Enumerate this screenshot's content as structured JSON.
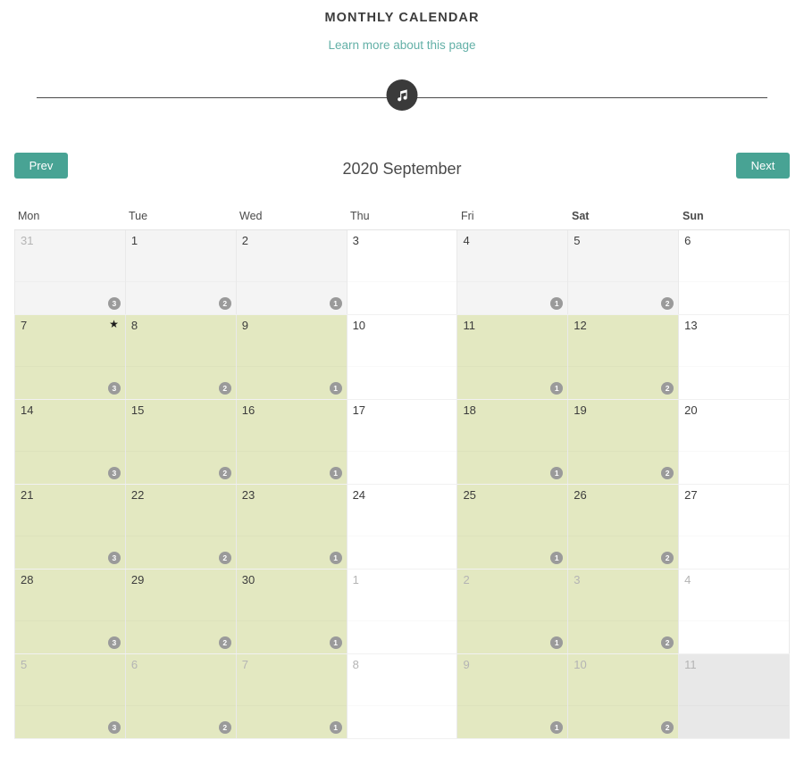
{
  "header": {
    "title": "MONTHLY CALENDAR",
    "subtitle_link": "Learn more about this page",
    "divider_icon": "music-note-icon"
  },
  "colors": {
    "accent_teal": "#48a394",
    "link_teal": "#63b0a7",
    "highlight_green": "#e3e8c1",
    "shade_grey": "#f4f4f4",
    "dim_grey": "#e8e8e8",
    "badge_grey": "#9a9a9a",
    "divider_dark": "#3a3a3a"
  },
  "nav": {
    "prev_label": "Prev",
    "next_label": "Next",
    "month_label": "2020 September"
  },
  "weekdays": [
    {
      "label": "Mon",
      "weekend": false
    },
    {
      "label": "Tue",
      "weekend": false
    },
    {
      "label": "Wed",
      "weekend": false
    },
    {
      "label": "Thu",
      "weekend": false
    },
    {
      "label": "Fri",
      "weekend": false
    },
    {
      "label": "Sat",
      "weekend": true
    },
    {
      "label": "Sun",
      "weekend": true
    }
  ],
  "calendar": {
    "rows": [
      {
        "cells": [
          {
            "date": "31",
            "othermonth": true,
            "shade": "grey",
            "badge": "3",
            "star": false
          },
          {
            "date": "1",
            "othermonth": false,
            "shade": "grey",
            "badge": "2",
            "star": false
          },
          {
            "date": "2",
            "othermonth": false,
            "shade": "grey",
            "badge": "1",
            "star": false
          },
          {
            "date": "3",
            "othermonth": false,
            "shade": "none",
            "badge": "",
            "star": false
          },
          {
            "date": "4",
            "othermonth": false,
            "shade": "grey",
            "badge": "1",
            "star": false
          },
          {
            "date": "5",
            "othermonth": false,
            "shade": "grey",
            "badge": "2",
            "star": false
          },
          {
            "date": "6",
            "othermonth": false,
            "shade": "none",
            "badge": "",
            "star": false
          }
        ]
      },
      {
        "cells": [
          {
            "date": "7",
            "othermonth": false,
            "shade": "green",
            "badge": "3",
            "star": true
          },
          {
            "date": "8",
            "othermonth": false,
            "shade": "green",
            "badge": "2",
            "star": false
          },
          {
            "date": "9",
            "othermonth": false,
            "shade": "green",
            "badge": "1",
            "star": false
          },
          {
            "date": "10",
            "othermonth": false,
            "shade": "none",
            "badge": "",
            "star": false
          },
          {
            "date": "11",
            "othermonth": false,
            "shade": "green",
            "badge": "1",
            "star": false
          },
          {
            "date": "12",
            "othermonth": false,
            "shade": "green",
            "badge": "2",
            "star": false
          },
          {
            "date": "13",
            "othermonth": false,
            "shade": "none",
            "badge": "",
            "star": false
          }
        ]
      },
      {
        "cells": [
          {
            "date": "14",
            "othermonth": false,
            "shade": "green",
            "badge": "3",
            "star": false
          },
          {
            "date": "15",
            "othermonth": false,
            "shade": "green",
            "badge": "2",
            "star": false
          },
          {
            "date": "16",
            "othermonth": false,
            "shade": "green",
            "badge": "1",
            "star": false
          },
          {
            "date": "17",
            "othermonth": false,
            "shade": "none",
            "badge": "",
            "star": false
          },
          {
            "date": "18",
            "othermonth": false,
            "shade": "green",
            "badge": "1",
            "star": false
          },
          {
            "date": "19",
            "othermonth": false,
            "shade": "green",
            "badge": "2",
            "star": false
          },
          {
            "date": "20",
            "othermonth": false,
            "shade": "none",
            "badge": "",
            "star": false
          }
        ]
      },
      {
        "cells": [
          {
            "date": "21",
            "othermonth": false,
            "shade": "green",
            "badge": "3",
            "star": false
          },
          {
            "date": "22",
            "othermonth": false,
            "shade": "green",
            "badge": "2",
            "star": false
          },
          {
            "date": "23",
            "othermonth": false,
            "shade": "green",
            "badge": "1",
            "star": false
          },
          {
            "date": "24",
            "othermonth": false,
            "shade": "none",
            "badge": "",
            "star": false
          },
          {
            "date": "25",
            "othermonth": false,
            "shade": "green",
            "badge": "1",
            "star": false
          },
          {
            "date": "26",
            "othermonth": false,
            "shade": "green",
            "badge": "2",
            "star": false
          },
          {
            "date": "27",
            "othermonth": false,
            "shade": "none",
            "badge": "",
            "star": false
          }
        ]
      },
      {
        "cells": [
          {
            "date": "28",
            "othermonth": false,
            "shade": "green",
            "badge": "3",
            "star": false
          },
          {
            "date": "29",
            "othermonth": false,
            "shade": "green",
            "badge": "2",
            "star": false
          },
          {
            "date": "30",
            "othermonth": false,
            "shade": "green",
            "badge": "1",
            "star": false
          },
          {
            "date": "1",
            "othermonth": true,
            "shade": "none",
            "badge": "",
            "star": false
          },
          {
            "date": "2",
            "othermonth": true,
            "shade": "green",
            "badge": "1",
            "star": false
          },
          {
            "date": "3",
            "othermonth": true,
            "shade": "green",
            "badge": "2",
            "star": false
          },
          {
            "date": "4",
            "othermonth": true,
            "shade": "none",
            "badge": "",
            "star": false
          }
        ]
      },
      {
        "cells": [
          {
            "date": "5",
            "othermonth": true,
            "shade": "green",
            "badge": "3",
            "star": false
          },
          {
            "date": "6",
            "othermonth": true,
            "shade": "green",
            "badge": "2",
            "star": false
          },
          {
            "date": "7",
            "othermonth": true,
            "shade": "green",
            "badge": "1",
            "star": false
          },
          {
            "date": "8",
            "othermonth": true,
            "shade": "none",
            "badge": "",
            "star": false
          },
          {
            "date": "9",
            "othermonth": true,
            "shade": "green",
            "badge": "1",
            "star": false
          },
          {
            "date": "10",
            "othermonth": true,
            "shade": "green",
            "badge": "2",
            "star": false
          },
          {
            "date": "11",
            "othermonth": true,
            "shade": "dim",
            "badge": "",
            "star": false
          }
        ]
      }
    ],
    "star_glyph": "★"
  }
}
